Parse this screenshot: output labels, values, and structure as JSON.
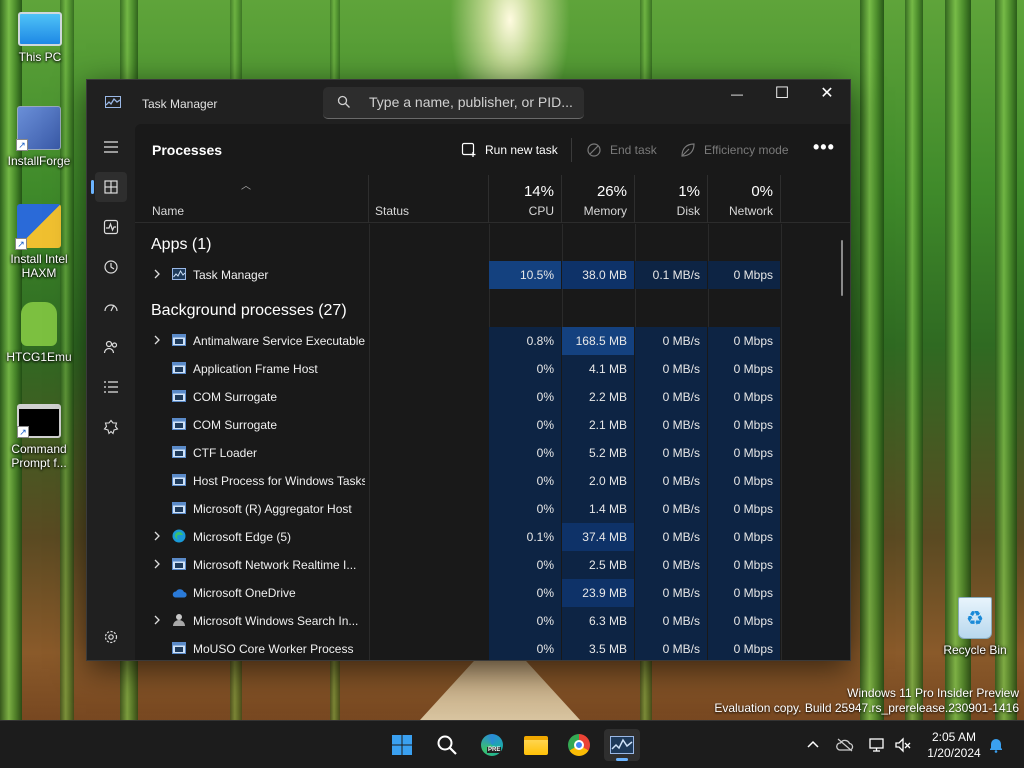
{
  "desktop": {
    "icons": [
      {
        "label": "This PC"
      },
      {
        "label": "InstallForge"
      },
      {
        "label": "Install Intel HAXM"
      },
      {
        "label": "HTCG1Emu"
      },
      {
        "label": "Command Prompt f..."
      },
      {
        "label": "Recycle Bin"
      }
    ],
    "watermark": {
      "line1": "Windows 11 Pro Insider Preview",
      "line2": "Evaluation copy. Build 25947.rs_prerelease.230901-1416"
    }
  },
  "window": {
    "title": "Task Manager",
    "search_placeholder": "Type a name, publisher, or PID...",
    "minimize": "—",
    "maximize": "☐",
    "close": "✕"
  },
  "sidebar": {
    "items": [
      {
        "name": "hamburger-icon"
      },
      {
        "name": "processes-icon"
      },
      {
        "name": "performance-icon"
      },
      {
        "name": "app-history-icon"
      },
      {
        "name": "startup-apps-icon"
      },
      {
        "name": "users-icon"
      },
      {
        "name": "details-icon"
      },
      {
        "name": "services-icon"
      },
      {
        "name": "settings-icon"
      }
    ]
  },
  "toolbar": {
    "page_title": "Processes",
    "run_new_task": "Run new task",
    "end_task": "End task",
    "efficiency_mode": "Efficiency mode",
    "more": "•••"
  },
  "columns": {
    "name": "Name",
    "status": "Status",
    "cpu": {
      "pct": "14%",
      "label": "CPU"
    },
    "memory": {
      "pct": "26%",
      "label": "Memory"
    },
    "disk": {
      "pct": "1%",
      "label": "Disk"
    },
    "network": {
      "pct": "0%",
      "label": "Network"
    }
  },
  "sections": {
    "apps": "Apps (1)",
    "background": "Background processes (27)"
  },
  "apps": [
    {
      "name": "Task Manager",
      "cpu": "10.5%",
      "memory": "38.0 MB",
      "disk": "0.1 MB/s",
      "network": "0 Mbps",
      "expandable": true,
      "icon": "task-manager-icon"
    }
  ],
  "background": [
    {
      "name": "Antimalware Service Executable",
      "cpu": "0.8%",
      "memory": "168.5 MB",
      "disk": "0 MB/s",
      "network": "0 Mbps",
      "expandable": true,
      "icon": "generic-app-icon"
    },
    {
      "name": "Application Frame Host",
      "cpu": "0%",
      "memory": "4.1 MB",
      "disk": "0 MB/s",
      "network": "0 Mbps",
      "expandable": false,
      "icon": "generic-app-icon"
    },
    {
      "name": "COM Surrogate",
      "cpu": "0%",
      "memory": "2.2 MB",
      "disk": "0 MB/s",
      "network": "0 Mbps",
      "expandable": false,
      "icon": "generic-app-icon"
    },
    {
      "name": "COM Surrogate",
      "cpu": "0%",
      "memory": "2.1 MB",
      "disk": "0 MB/s",
      "network": "0 Mbps",
      "expandable": false,
      "icon": "generic-app-icon"
    },
    {
      "name": "CTF Loader",
      "cpu": "0%",
      "memory": "5.2 MB",
      "disk": "0 MB/s",
      "network": "0 Mbps",
      "expandable": false,
      "icon": "generic-app-icon"
    },
    {
      "name": "Host Process for Windows Tasks",
      "cpu": "0%",
      "memory": "2.0 MB",
      "disk": "0 MB/s",
      "network": "0 Mbps",
      "expandable": false,
      "icon": "generic-app-icon"
    },
    {
      "name": "Microsoft (R) Aggregator Host",
      "cpu": "0%",
      "memory": "1.4 MB",
      "disk": "0 MB/s",
      "network": "0 Mbps",
      "expandable": false,
      "icon": "generic-app-icon"
    },
    {
      "name": "Microsoft Edge (5)",
      "cpu": "0.1%",
      "memory": "37.4 MB",
      "disk": "0 MB/s",
      "network": "0 Mbps",
      "expandable": true,
      "icon": "edge-icon"
    },
    {
      "name": "Microsoft Network Realtime I...",
      "cpu": "0%",
      "memory": "2.5 MB",
      "disk": "0 MB/s",
      "network": "0 Mbps",
      "expandable": true,
      "icon": "generic-app-icon"
    },
    {
      "name": "Microsoft OneDrive",
      "cpu": "0%",
      "memory": "23.9 MB",
      "disk": "0 MB/s",
      "network": "0 Mbps",
      "expandable": false,
      "icon": "onedrive-icon"
    },
    {
      "name": "Microsoft Windows Search In...",
      "cpu": "0%",
      "memory": "6.3 MB",
      "disk": "0 MB/s",
      "network": "0 Mbps",
      "expandable": true,
      "icon": "search-indexer-icon"
    },
    {
      "name": "MoUSO Core Worker Process",
      "cpu": "0%",
      "memory": "3.5 MB",
      "disk": "0 MB/s",
      "network": "0 Mbps",
      "expandable": false,
      "icon": "generic-app-icon"
    }
  ],
  "taskbar": {
    "apps": [
      {
        "name": "start-icon"
      },
      {
        "name": "search-icon"
      },
      {
        "name": "edge-beta-icon",
        "badge": "PRE"
      },
      {
        "name": "file-explorer-icon"
      },
      {
        "name": "chrome-icon"
      },
      {
        "name": "task-manager-icon"
      }
    ],
    "tray": [
      "chevron-up-icon",
      "onedrive-icon",
      "network-icon",
      "volume-mute-icon"
    ],
    "time": "2:05 AM",
    "date": "1/20/2024",
    "notification": "bell-icon"
  },
  "colors": {
    "accent": "#6cb4ff",
    "heat_low": "#0d2444",
    "heat_mid": "#0e3268",
    "heat_high": "#14417f"
  }
}
